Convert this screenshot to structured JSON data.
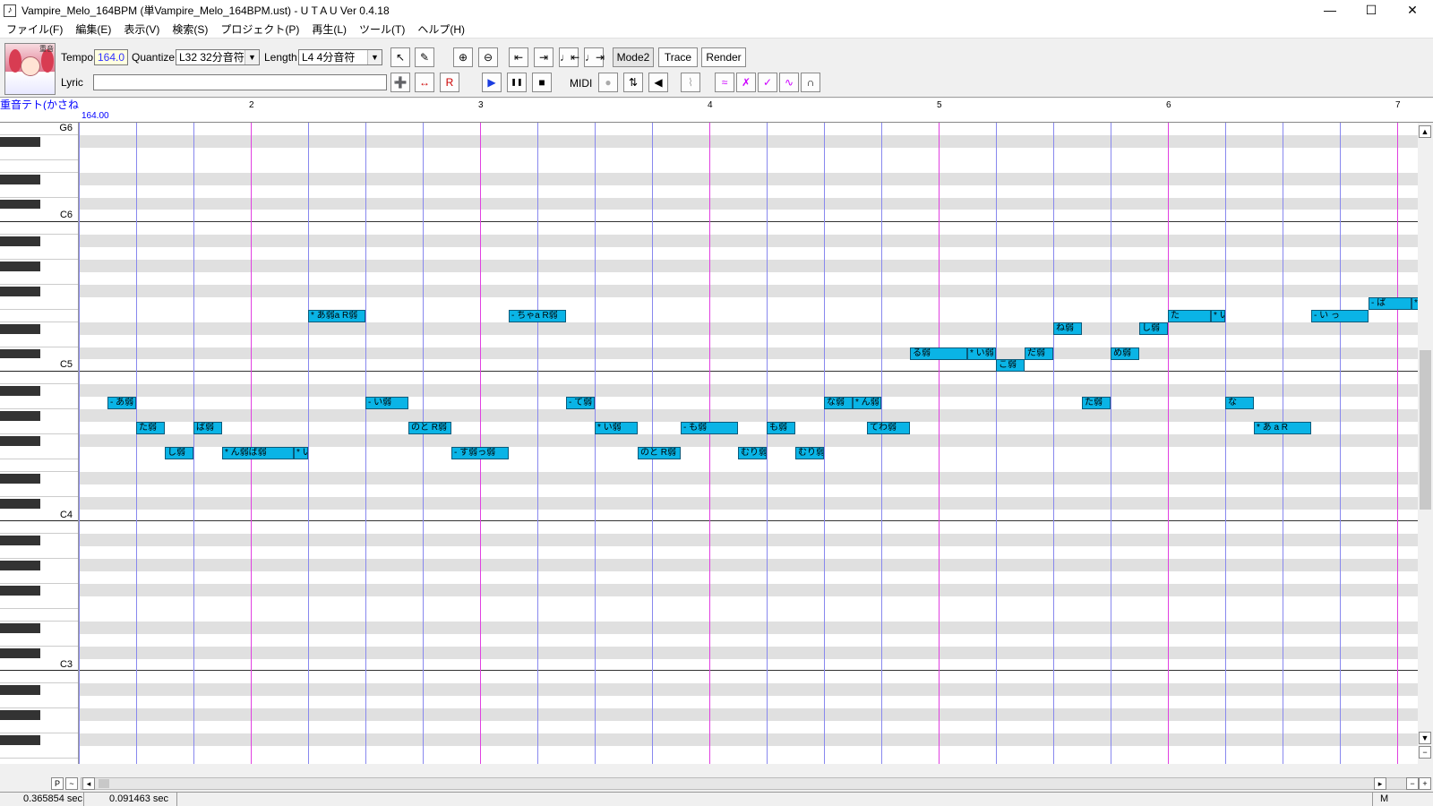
{
  "window": {
    "title": "Vampire_Melo_164BPM (単Vampire_Melo_164BPM.ust) - U T A U Ver 0.4.18",
    "minimize": "—",
    "maximize": "☐",
    "close": "✕",
    "icon": "♪"
  },
  "menu": [
    "ファイル(F)",
    "編集(E)",
    "表示(V)",
    "検索(S)",
    "プロジェクト(P)",
    "再生(L)",
    "ツール(T)",
    "ヘルプ(H)"
  ],
  "toolbar": {
    "avatar_tag": "重音",
    "tempo_label": "Tempo",
    "tempo_value": "164.0",
    "quantize_label": "Quantize",
    "quantize_value": "L32 32分音符",
    "length_label": "Length",
    "length_value": "L4  4分音符",
    "lyric_label": "Lyric",
    "lyric_value": "",
    "mode2": "Mode2",
    "trace": "Trace",
    "render": "Render",
    "midi": "MIDI",
    "icons_row1": [
      "↖",
      "✎",
      "⊕",
      "⊖",
      "⇤",
      "⇥",
      "♩⇤",
      "♩⇥"
    ],
    "icons_row2": [
      "➕",
      "↔",
      "R",
      "▶",
      "❚❚",
      "■",
      "●",
      "⇅",
      "◀",
      "⌇",
      "≈",
      "✗",
      "✓",
      "∿",
      "∩"
    ]
  },
  "ruler": {
    "voice": "重音テト(かさね)(てと)音声ライブラリ",
    "tempo": "164.00",
    "bars": [
      "2",
      "3",
      "4",
      "5",
      "6",
      "7"
    ]
  },
  "keyboard": {
    "labels": [
      "G6",
      "C6",
      "C5",
      "C4",
      "C3"
    ]
  },
  "notes": [
    {
      "lyric": "- あ弱",
      "pitch": "A4",
      "beat": 0.5,
      "len": 0.5
    },
    {
      "lyric": "た弱",
      "pitch": "G4",
      "beat": 1,
      "len": 0.5
    },
    {
      "lyric": "し弱",
      "pitch": "F4",
      "beat": 1.5,
      "len": 0.5
    },
    {
      "lyric": "ば弱",
      "pitch": "G4",
      "beat": 2,
      "len": 0.5
    },
    {
      "lyric": "* ん弱ば弱",
      "pitch": "F4",
      "beat": 2.5,
      "len": 1.25
    },
    {
      "lyric": "* い弱",
      "pitch": "F4",
      "beat": 3.75,
      "len": 0.25
    },
    {
      "lyric": "* あ弱a R弱",
      "pitch": "E5",
      "beat": 4,
      "len": 1
    },
    {
      "lyric": "- い弱",
      "pitch": "A4",
      "beat": 5,
      "len": 0.75
    },
    {
      "lyric": "のと R弱",
      "pitch": "G4",
      "beat": 5.75,
      "len": 0.75
    },
    {
      "lyric": "- す弱っ弱",
      "pitch": "F4",
      "beat": 6.5,
      "len": 1
    },
    {
      "lyric": "- ちゃa R弱",
      "pitch": "E5",
      "beat": 7.5,
      "len": 1
    },
    {
      "lyric": "- て弱",
      "pitch": "A4",
      "beat": 8.5,
      "len": 0.5
    },
    {
      "lyric": "* い弱",
      "pitch": "G4",
      "beat": 9,
      "len": 0.75
    },
    {
      "lyric": "のと R弱",
      "pitch": "F4",
      "beat": 9.75,
      "len": 0.75
    },
    {
      "lyric": "- も弱",
      "pitch": "G4",
      "beat": 10.5,
      "len": 1
    },
    {
      "lyric": "むり弱",
      "pitch": "F4",
      "beat": 11.5,
      "len": 0.5
    },
    {
      "lyric": "も弱",
      "pitch": "G4",
      "beat": 12,
      "len": 0.5
    },
    {
      "lyric": "むり弱",
      "pitch": "F4",
      "beat": 12.5,
      "len": 0.5
    },
    {
      "lyric": "な弱",
      "pitch": "A4",
      "beat": 13,
      "len": 0.5
    },
    {
      "lyric": "* ん弱",
      "pitch": "A4",
      "beat": 13.5,
      "len": 0.5
    },
    {
      "lyric": "てわ弱",
      "pitch": "G4",
      "beat": 13.75,
      "len": 0.75
    },
    {
      "lyric": "る弱",
      "pitch": "C#5",
      "beat": 14.5,
      "len": 1
    },
    {
      "lyric": "* い弱",
      "pitch": "C#5",
      "beat": 15.5,
      "len": 0.5
    },
    {
      "lyric": "こ弱",
      "pitch": "C5",
      "beat": 16,
      "len": 0.5
    },
    {
      "lyric": "だ弱",
      "pitch": "C#5",
      "beat": 16.5,
      "len": 0.5
    },
    {
      "lyric": "ね弱",
      "pitch": "D#5",
      "beat": 17,
      "len": 0.5
    },
    {
      "lyric": "た弱",
      "pitch": "A4",
      "beat": 17.5,
      "len": 0.5
    },
    {
      "lyric": "め弱",
      "pitch": "C#5",
      "beat": 18,
      "len": 0.5
    },
    {
      "lyric": "し弱",
      "pitch": "D#5",
      "beat": 18.5,
      "len": 0.5
    },
    {
      "lyric": "た",
      "pitch": "E5",
      "beat": 19,
      "len": 0.75
    },
    {
      "lyric": "* い",
      "pitch": "E5",
      "beat": 19.75,
      "len": 0.25
    },
    {
      "lyric": "な",
      "pitch": "A4",
      "beat": 20,
      "len": 0.5
    },
    {
      "lyric": "* あ  a R",
      "pitch": "G4",
      "beat": 20.5,
      "len": 1
    },
    {
      "lyric": "- い  っ",
      "pitch": "E5",
      "beat": 21.5,
      "len": 1
    },
    {
      "lyric": "- ぱ",
      "pitch": "F5",
      "beat": 22.5,
      "len": 0.75
    },
    {
      "lyric": "*",
      "pitch": "F5",
      "beat": 23.25,
      "len": 0.25
    }
  ],
  "scroll": {
    "p": "P",
    "tilde": "~",
    "left": "◂",
    "right": "▸",
    "minus": "−",
    "plus": "+",
    "up": "▲",
    "down": "▼",
    "vminus": "−",
    "vplus": "+"
  },
  "status": {
    "time1": "0.365854 sec",
    "time2": "0.091463 sec",
    "mode": "M"
  },
  "colors": {
    "note": "#0ab4e6",
    "bar_line": "#e040e0",
    "beat_line": "#8888ee",
    "black_row": "#e0e0e0",
    "voice_text": "#0000ff"
  }
}
